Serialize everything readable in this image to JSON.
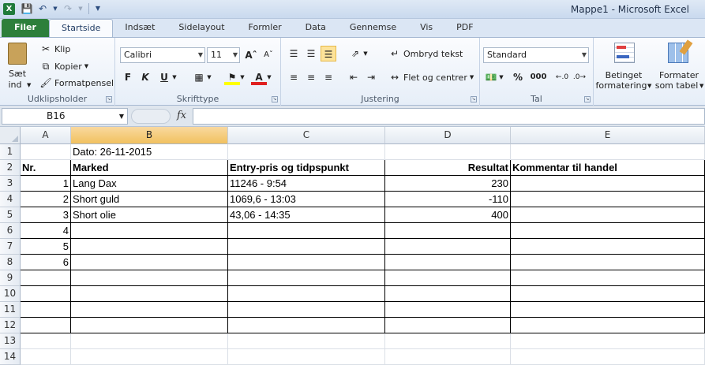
{
  "window": {
    "title": "Mappe1 - Microsoft Excel",
    "app_icon": "X"
  },
  "tabs": [
    "Filer",
    "Startside",
    "Indsæt",
    "Sidelayout",
    "Formler",
    "Data",
    "Gennemse",
    "Vis",
    "PDF"
  ],
  "ribbon": {
    "clipboard": {
      "paste_line1": "Sæt",
      "paste_line2": "ind",
      "cut": "Klip",
      "copy": "Kopier",
      "format_painter": "Formatpensel",
      "label": "Udklipsholder"
    },
    "font": {
      "name": "Calibri",
      "size": "11",
      "bold": "F",
      "italic": "K",
      "underline": "U",
      "label": "Skrifttype"
    },
    "alignment": {
      "wrap": "Ombryd tekst",
      "merge": "Flet og centrer",
      "label": "Justering"
    },
    "number": {
      "format": "Standard",
      "percent": "%",
      "thousands": "000",
      "label": "Tal"
    },
    "styles": {
      "conditional_line1": "Betinget",
      "conditional_line2": "formatering",
      "table_line1": "Formater",
      "table_line2": "som tabel"
    }
  },
  "formula_bar": {
    "name_box": "B16",
    "fx": "fx",
    "value": ""
  },
  "columns": [
    "A",
    "B",
    "C",
    "D",
    "E"
  ],
  "selected_column": "B",
  "rows": [
    "1",
    "2",
    "3",
    "4",
    "5",
    "6",
    "7",
    "8",
    "9",
    "10",
    "11",
    "12",
    "13",
    "14"
  ],
  "cells": {
    "r1": {
      "B": "Dato: 26-11-2015"
    },
    "r2": {
      "A": "Nr.",
      "B": "Marked",
      "C": "Entry-pris og tidpspunkt",
      "D": "Resultat",
      "E": "Kommentar til handel"
    },
    "r3": {
      "A": "1",
      "B": "Lang Dax",
      "C": "11246 - 9:54",
      "D": "230"
    },
    "r4": {
      "A": "2",
      "B": "Short guld",
      "C": "1069,6 - 13:03",
      "D": "-110"
    },
    "r5": {
      "A": "3",
      "B": "Short olie",
      "C": "43,06 - 14:35",
      "D": "400"
    },
    "r6": {
      "A": "4"
    },
    "r7": {
      "A": "5"
    },
    "r8": {
      "A": "6"
    }
  },
  "colors": {
    "file_tab": "#2d7f3b",
    "selection_header": "#f1c15f",
    "ribbon": "#e6eef8"
  }
}
